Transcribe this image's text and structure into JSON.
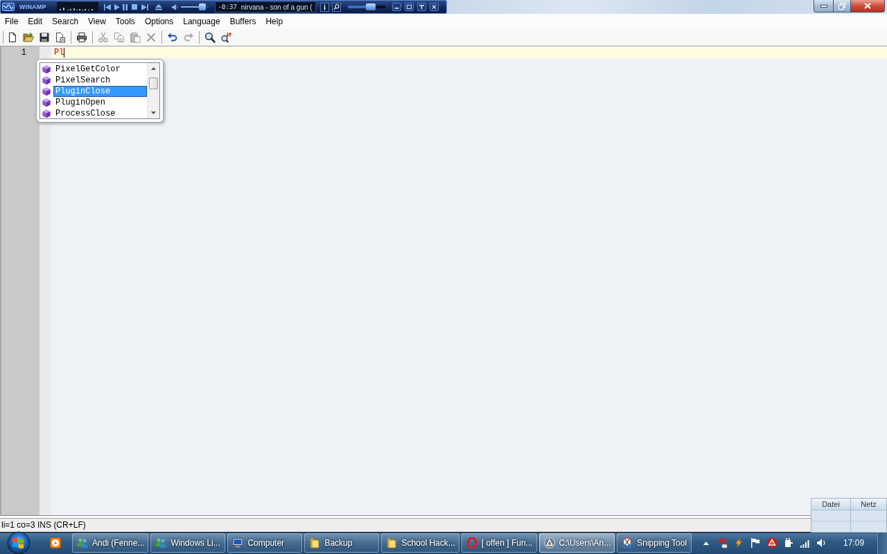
{
  "media_player": {
    "title": "WINAMP",
    "volume": {
      "level": 0.88
    },
    "time": "-0:37",
    "track": "nirvana - son of a gun (",
    "second_slider": {
      "level": 0.67
    }
  },
  "menu": [
    "File",
    "Edit",
    "Search",
    "View",
    "Tools",
    "Options",
    "Language",
    "Buffers",
    "Help"
  ],
  "toolbar": [
    {
      "kind": "new",
      "disabled": false
    },
    {
      "kind": "open",
      "disabled": false
    },
    {
      "kind": "save",
      "disabled": false
    },
    {
      "kind": "close",
      "disabled": false
    },
    {
      "kind": "separator"
    },
    {
      "kind": "print",
      "disabled": false
    },
    {
      "kind": "separator"
    },
    {
      "kind": "cut",
      "disabled": true
    },
    {
      "kind": "copy",
      "disabled": true
    },
    {
      "kind": "paste",
      "disabled": true
    },
    {
      "kind": "delete",
      "disabled": true
    },
    {
      "kind": "separator"
    },
    {
      "kind": "undo",
      "disabled": false
    },
    {
      "kind": "redo",
      "disabled": true
    },
    {
      "kind": "separator"
    },
    {
      "kind": "find",
      "disabled": false
    },
    {
      "kind": "replace",
      "disabled": false
    }
  ],
  "editor": {
    "lines": [
      {
        "number": "1",
        "text": "Pl",
        "current": true
      }
    ],
    "autocomplete": {
      "items": [
        {
          "label": "PixelGetColor",
          "selected": false
        },
        {
          "label": "PixelSearch",
          "selected": false
        },
        {
          "label": "PluginClose",
          "selected": true
        },
        {
          "label": "PluginOpen",
          "selected": false
        },
        {
          "label": "ProcessClose",
          "selected": false
        }
      ]
    }
  },
  "status_bar": "li=1 co=3 INS (CR+LF)",
  "gadget_table": {
    "columns": [
      "Datei",
      "Netz"
    ]
  },
  "taskbar": {
    "buttons": [
      {
        "label": "Andi (Fenne...",
        "kind": "people",
        "selected": false
      },
      {
        "label": "Windows Li...",
        "kind": "people",
        "selected": false
      },
      {
        "label": "Computer",
        "kind": "computer",
        "selected": false
      },
      {
        "label": "Backup",
        "kind": "folder",
        "selected": false
      },
      {
        "label": "School Hack...",
        "kind": "folder",
        "selected": false
      },
      {
        "label": "[ offen ] Fun...",
        "kind": "ring",
        "selected": false
      },
      {
        "label": "C:\\Users\\An...",
        "kind": "disc",
        "selected": true
      },
      {
        "label": "Snipping Tool",
        "kind": "scissors",
        "selected": false
      }
    ],
    "clock": "17:09"
  }
}
